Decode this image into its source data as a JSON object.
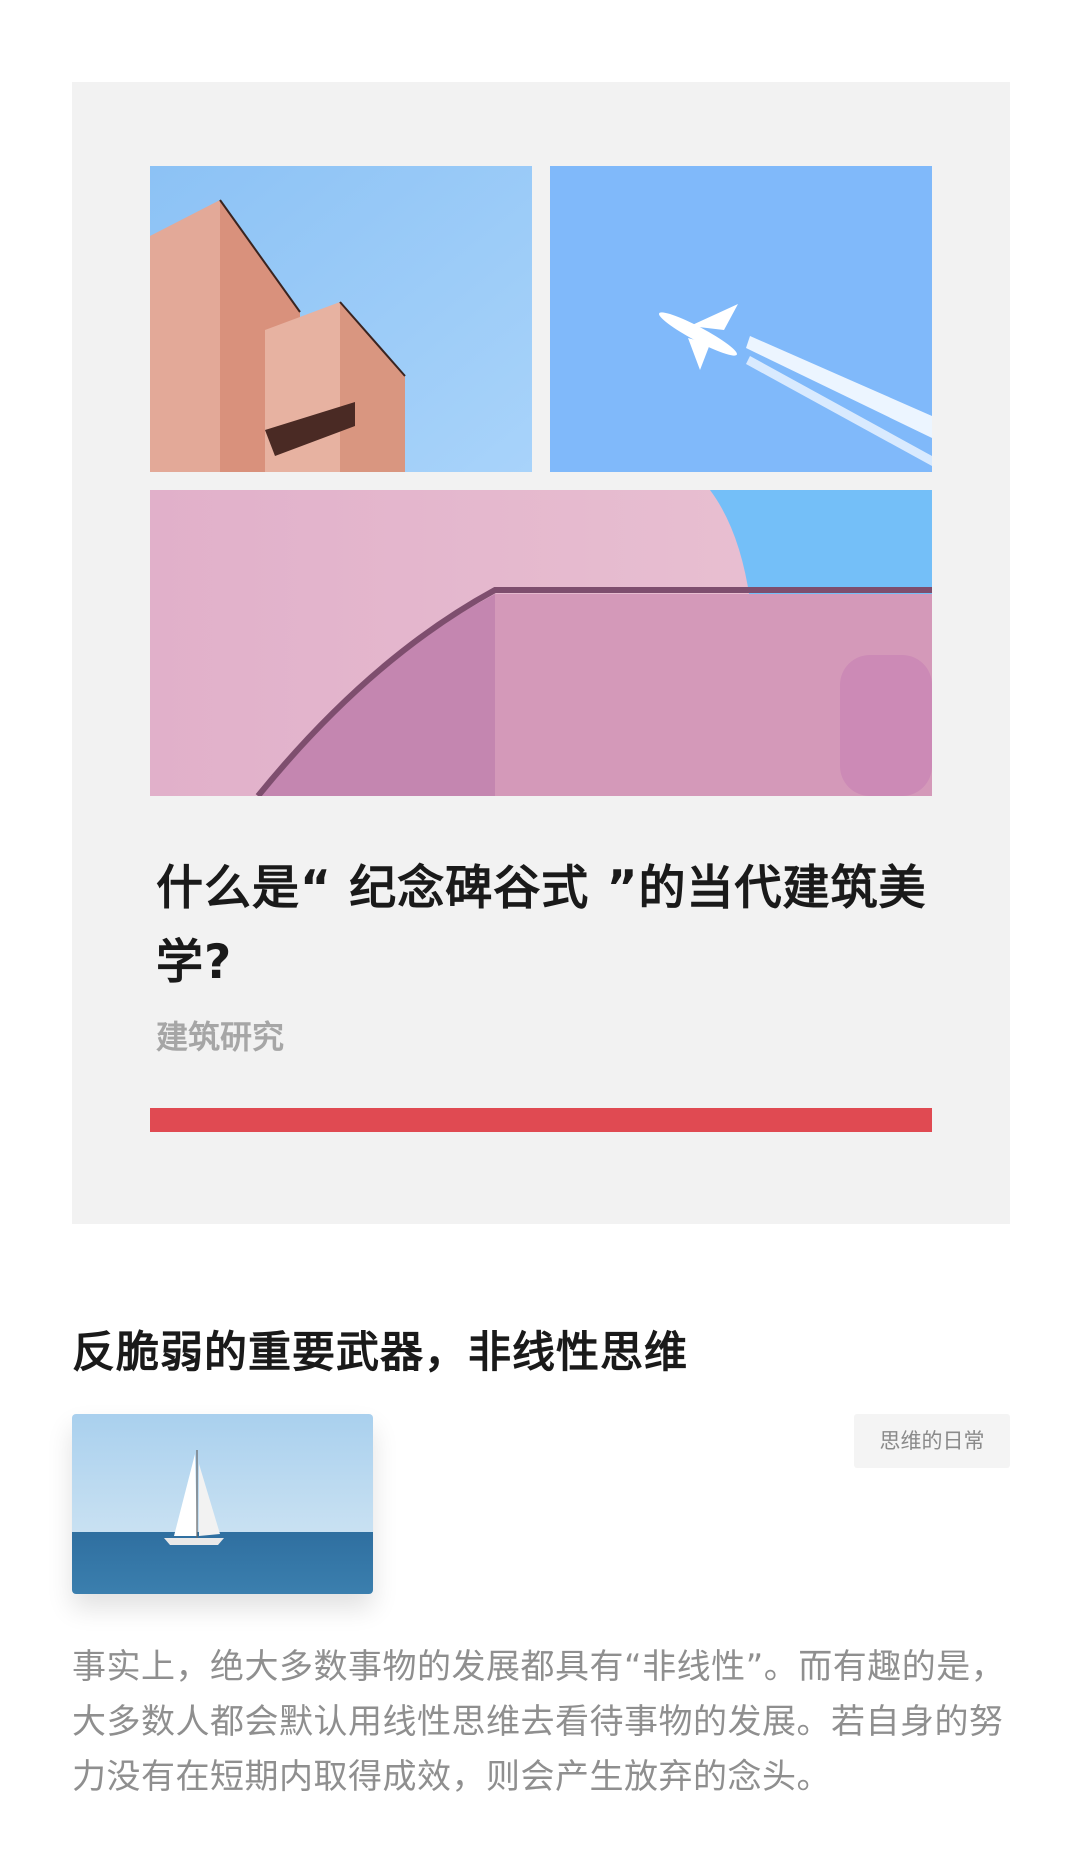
{
  "feature": {
    "title": "什么是“ 纪念碑谷式 ”的当代建筑美学?",
    "category": "建筑研究",
    "accent_color": "#e04a52",
    "images": [
      "building-photo",
      "airplane-photo",
      "pink-architecture-photo"
    ]
  },
  "article": {
    "title": "反脆弱的重要武器，非线性思维",
    "tag": "思维的日常",
    "thumbnail": "sailboat-photo",
    "excerpt": "事实上，绝大多数事物的发展都具有“非线性”。而有趣的是，大多数人都会默认用线性思维去看待事物的发展。若自身的努力没有在短期内取得成效，则会产生放弃的念头。"
  }
}
